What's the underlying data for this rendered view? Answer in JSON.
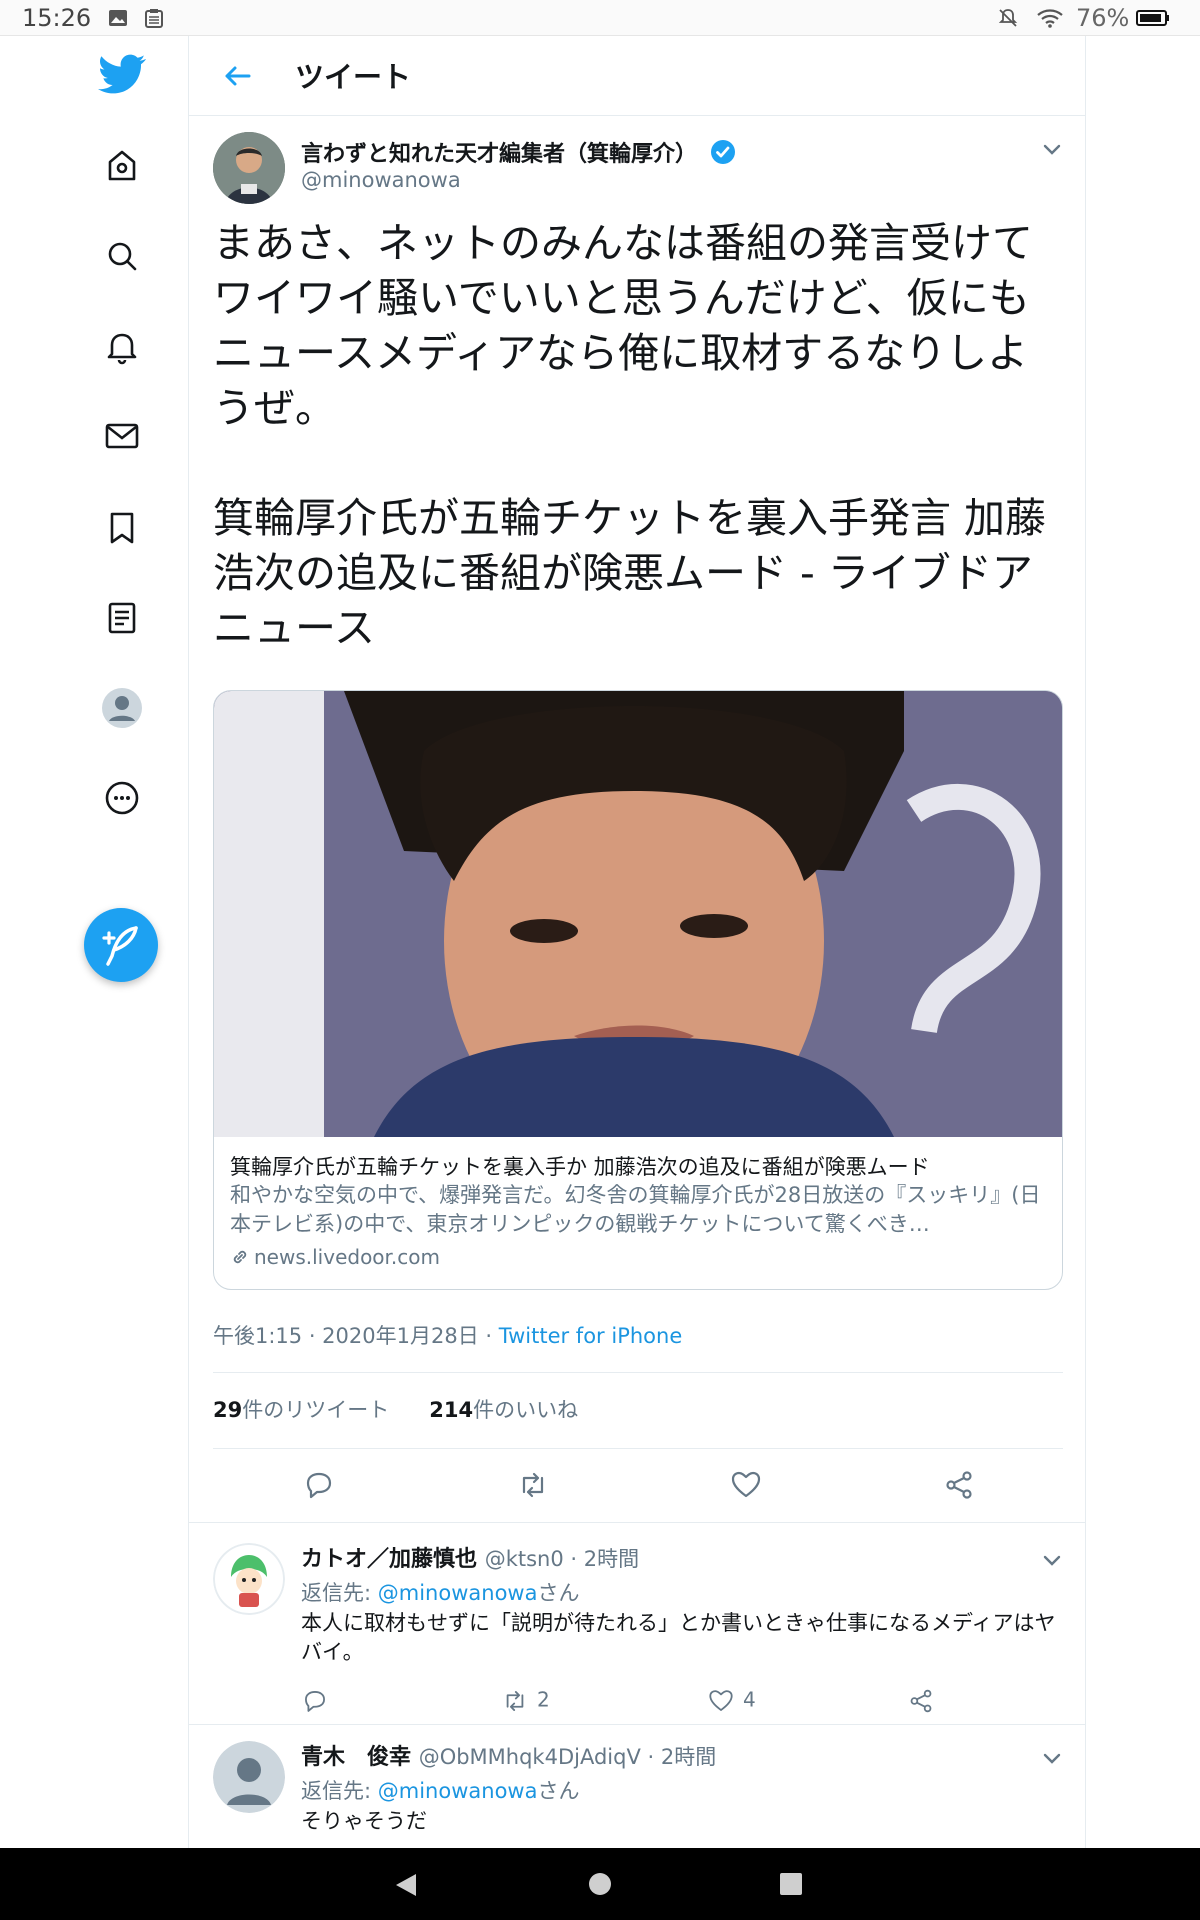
{
  "status_bar": {
    "time": "15:26",
    "battery": "76%"
  },
  "header": {
    "title": "ツイート"
  },
  "tweet": {
    "author_name": "言わずと知れた天才編集者（箕輪厚介）",
    "author_handle": "@minowanowa",
    "text": "まあさ、ネットのみんなは番組の発言受けて\nワイワイ騒いでいいと思うんだけど、仮にも\nニュースメディアなら俺に取材するなりしよ\nうぜ。\n\n箕輪厚介氏が五輪チケットを裏入手発言 加藤\n浩次の追及に番組が険悪ムード - ライブドア\nニュース",
    "card": {
      "title": "箕輪厚介氏が五輪チケットを裏入手か 加藤浩次の追及に番組が険悪ムード",
      "description": "和やかな空気の中で、爆弾発言だ。幻冬舎の箕輪厚介氏が28日放送の『スッキリ』(日本テレビ系)の中で、東京オリンピックの観戦チケットについて驚くべき…",
      "domain": "news.livedoor.com"
    },
    "timestamp": "午後1:15 · 2020年1月28日 · ",
    "source": "Twitter for iPhone",
    "retweet_count": "29",
    "retweet_label": "件のリツイート",
    "like_count": "214",
    "like_label": "件のいいね"
  },
  "replies": [
    {
      "name": "カトオ／加藤慎也",
      "handle": "@ktsn0 · 2時間",
      "reply_to_prefix": "返信先: ",
      "reply_to_mention": "@minowanowa",
      "reply_to_suffix": "さん",
      "text": "本人に取材もせずに「説明が待たれる」とか書いときゃ仕事になるメディアはヤバイ。",
      "retweets": "2",
      "likes": "4"
    },
    {
      "name": "青木　俊幸",
      "handle": "@ObMMhqk4DjAdiqV · 2時間",
      "reply_to_prefix": "返信先: ",
      "reply_to_mention": "@minowanowa",
      "reply_to_suffix": "さん",
      "text": "そりゃそうだ"
    }
  ],
  "colors": {
    "accent": "#1da1f2",
    "text_secondary": "#657786",
    "border": "#e6ecf0"
  }
}
